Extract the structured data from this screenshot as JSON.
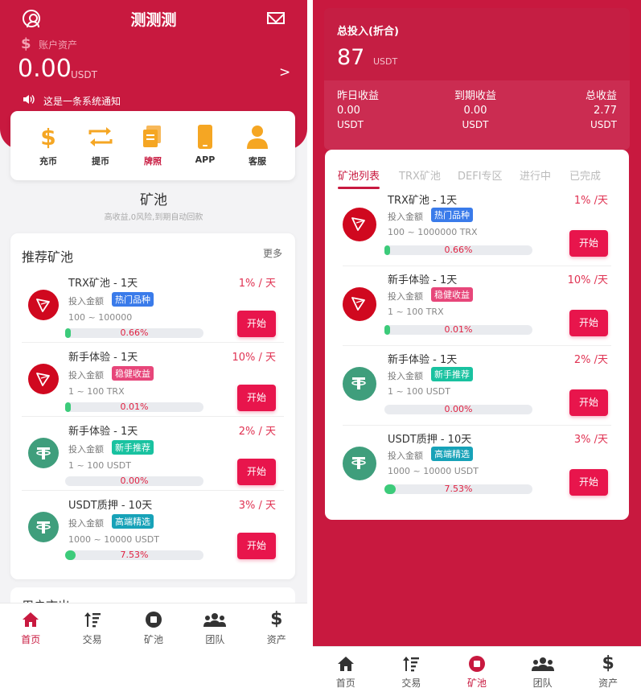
{
  "left": {
    "header": {
      "title": "测测测",
      "account_label": "账户资产",
      "amount": "0.00",
      "amount_unit": "USDT",
      "chevron": ">",
      "notice": "这是一条系统通知"
    },
    "quick_actions": [
      {
        "label": "充币",
        "icon": "dollar-icon"
      },
      {
        "label": "提币",
        "icon": "transfer-icon"
      },
      {
        "label": "牌照",
        "icon": "license-icon"
      },
      {
        "label": "APP",
        "icon": "phone-icon"
      },
      {
        "label": "客服",
        "icon": "support-icon"
      }
    ],
    "section_title": "矿池",
    "section_sub": "高收益,0风险,到期自动回款",
    "card_title": "推荐矿池",
    "more": "更多",
    "peek_title": "用户市出",
    "pools": [
      {
        "name": "TRX矿池 - 1天",
        "rate": "1% / 天",
        "invest_label": "投入金额",
        "tag": "热门品种",
        "tag_color": "#3a7bea",
        "range": "100 ~ 100000",
        "progress_text": "0.66%",
        "progress": 0.0066,
        "button": "开始",
        "coin": "trx"
      },
      {
        "name": "新手体验 - 1天",
        "rate": "10% / 天",
        "invest_label": "投入金额",
        "tag": "稳健收益",
        "tag_color": "#e7467a",
        "range": "1 ~ 100 TRX",
        "progress_text": "0.01%",
        "progress": 0.0001,
        "button": "开始",
        "coin": "trx"
      },
      {
        "name": "新手体验 - 1天",
        "rate": "2% / 天",
        "invest_label": "投入金额",
        "tag": "新手推荐",
        "tag_color": "#19c2a0",
        "range": "1 ~ 100 USDT",
        "progress_text": "0.00%",
        "progress": 0,
        "button": "开始",
        "coin": "usdt"
      },
      {
        "name": "USDT质押 - 10天",
        "rate": "3% / 天",
        "invest_label": "投入金额",
        "tag": "高端精选",
        "tag_color": "#17a2b8",
        "range": "1000 ~ 10000 USDT",
        "progress_text": "7.53%",
        "progress": 0.0753,
        "button": "开始",
        "coin": "usdt"
      }
    ],
    "tabs": [
      {
        "label": "首页",
        "icon": "home-icon"
      },
      {
        "label": "交易",
        "icon": "sort-icon"
      },
      {
        "label": "矿池",
        "icon": "stop-circle-icon"
      },
      {
        "label": "团队",
        "icon": "team-icon"
      },
      {
        "label": "资产",
        "icon": "dollar-icon"
      }
    ]
  },
  "right": {
    "total_label": "总投入(折合)",
    "total_value": "87",
    "total_unit": "USDT",
    "stats": [
      {
        "label": "昨日收益",
        "value": "0.00",
        "unit": "USDT"
      },
      {
        "label": "到期收益",
        "value": "0.00",
        "unit": "USDT"
      },
      {
        "label": "总收益",
        "value": "2.77",
        "unit": "USDT"
      }
    ],
    "filter_tabs": [
      "矿池列表",
      "TRX矿池",
      "DEFI专区",
      "进行中",
      "已完成"
    ],
    "pools": [
      {
        "name": "TRX矿池 - 1天",
        "rate": "1% /天",
        "invest_label": "投入金额",
        "tag": "热门品种",
        "tag_color": "#3a7bea",
        "range": "100 ~ 1000000 TRX",
        "progress_text": "0.66%",
        "progress": 0.0066,
        "button": "开始",
        "coin": "trx"
      },
      {
        "name": "新手体验 - 1天",
        "rate": "10% /天",
        "invest_label": "投入金额",
        "tag": "稳健收益",
        "tag_color": "#e7467a",
        "range": "1 ~ 100 TRX",
        "progress_text": "0.01%",
        "progress": 0.0001,
        "button": "开始",
        "coin": "trx"
      },
      {
        "name": "新手体验 - 1天",
        "rate": "2% /天",
        "invest_label": "投入金额",
        "tag": "新手推荐",
        "tag_color": "#19c2a0",
        "range": "1 ~ 100 USDT",
        "progress_text": "0.00%",
        "progress": 0,
        "button": "开始",
        "coin": "usdt"
      },
      {
        "name": "USDT质押 - 10天",
        "rate": "3% /天",
        "invest_label": "投入金额",
        "tag": "高端精选",
        "tag_color": "#17a2b8",
        "range": "1000 ~ 10000 USDT",
        "progress_text": "7.53%",
        "progress": 0.0753,
        "button": "开始",
        "coin": "usdt"
      }
    ],
    "tabs": [
      {
        "label": "首页",
        "icon": "home-icon"
      },
      {
        "label": "交易",
        "icon": "sort-icon"
      },
      {
        "label": "矿池",
        "icon": "stop-circle-icon"
      },
      {
        "label": "团队",
        "icon": "team-icon"
      },
      {
        "label": "资产",
        "icon": "dollar-icon"
      }
    ]
  }
}
